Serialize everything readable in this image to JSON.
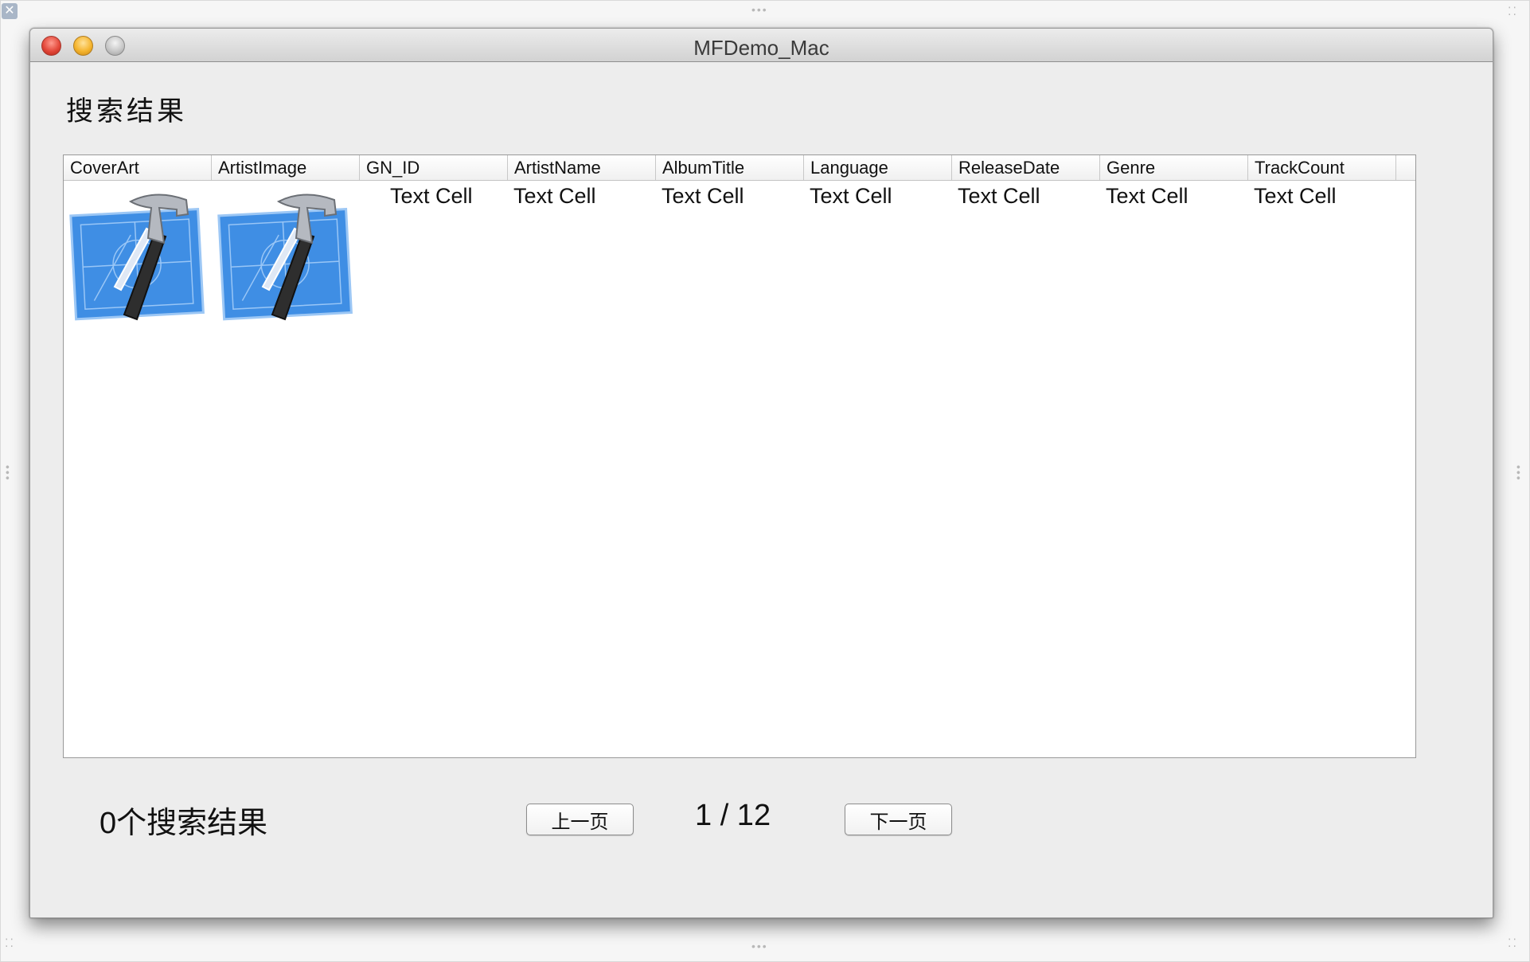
{
  "window": {
    "title": "MFDemo_Mac"
  },
  "heading": "搜索结果",
  "table": {
    "columns": [
      "CoverArt",
      "ArtistImage",
      "GN_ID",
      "ArtistName",
      "AlbumTitle",
      "Language",
      "ReleaseDate",
      "Genre",
      "TrackCount"
    ],
    "row": {
      "cover_icon": "xcode-hammer-blueprint-icon",
      "artist_icon": "xcode-hammer-blueprint-icon",
      "cells": [
        "Text Cell",
        "Text Cell",
        "Text Cell",
        "Text Cell",
        "Text Cell",
        "Text Cell",
        "Text Cell"
      ]
    }
  },
  "footer": {
    "count_label": "0个搜索结果",
    "prev_label": "上一页",
    "page_indicator": "1 / 12",
    "next_label": "下一页"
  },
  "colors": {
    "accent_blue": "#3f8ee4",
    "window_bg": "#ededed"
  }
}
